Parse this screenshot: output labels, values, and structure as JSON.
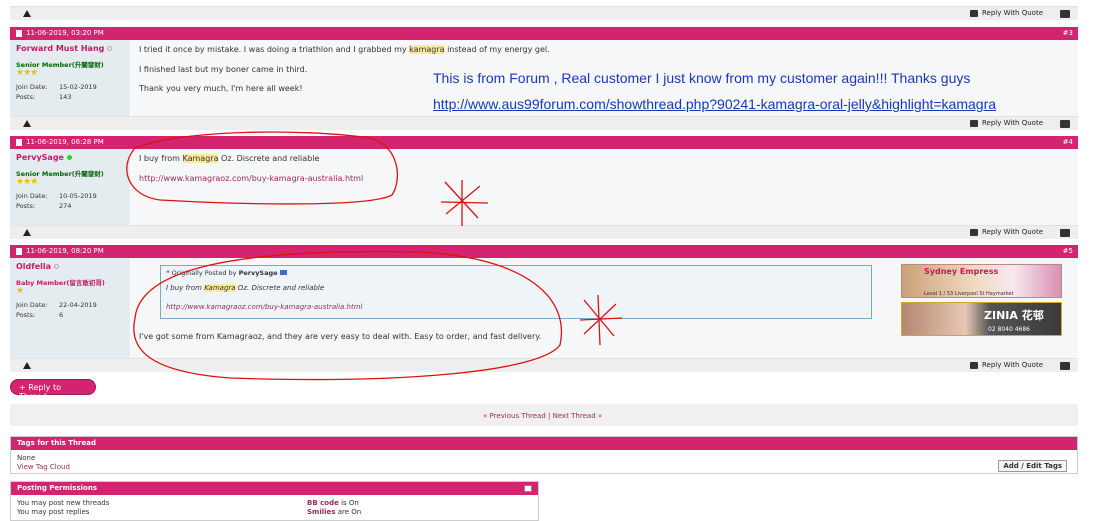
{
  "toolbar": {
    "reply_quote": "Reply With Quote"
  },
  "posts": [
    {
      "date": "11-06-2019, 03:20 PM",
      "number": "#3",
      "user": {
        "name": "Forward Must Hang",
        "rank": "Senior Member(升關發財)",
        "stars": "★★★",
        "join_label": "Join Date:",
        "join": "15-02-2019",
        "posts_label": "Posts:",
        "posts": "143"
      },
      "body": {
        "line1_pre": "I tried it once by mistake. I was doing a triathlon and I grabbed my ",
        "line1_hl": "kamagra",
        "line1_post": " instead of my energy gel.",
        "line2": "I finished last but my boner came in third.",
        "line3": "Thank you very much, I'm here all week!"
      }
    },
    {
      "date": "11-06-2019, 06:28 PM",
      "number": "#4",
      "user": {
        "name": "PervySage",
        "rank": "Senior Member(升關發財)",
        "stars": "★★★",
        "join_label": "Join Date:",
        "join": "10-05-2019",
        "posts_label": "Posts:",
        "posts": "274"
      },
      "body": {
        "line1_pre": "I buy from ",
        "line1_hl": "Kamagra",
        "line1_post": " Oz. Discrete and reliable",
        "link": "http://www.kamagraoz.com/buy-kamagra-australia.html"
      }
    },
    {
      "date": "11-06-2019, 08:20 PM",
      "number": "#5",
      "user": {
        "name": "Oldfella",
        "rank": "Baby Member(留言敢初哥)",
        "stars": "★",
        "join_label": "Join Date:",
        "join": "22-04-2019",
        "posts_label": "Posts:",
        "posts": "6"
      },
      "quote": {
        "by_label": "Originally Posted by",
        "by": "PervySage",
        "line1_pre": "I buy from ",
        "line1_hl": "Kamagra",
        "line1_post": " Oz. Discrete and reliable",
        "link": "http://www.kamagraoz.com/buy-kamagra-australia.html"
      },
      "body": {
        "line": "I've got some from Kamagraoz, and they are very easy to deal with. Easy to order, and fast delivery."
      }
    }
  ],
  "annotation": {
    "text": "This is from Forum , Real customer I just know from my customer again!!! Thanks guys",
    "link": "http://www.aus99forum.com/showthread.php?90241-kamagra-oral-jelly&highlight=kamagra"
  },
  "ads": {
    "ad1_title": "Sydney Empress",
    "ad1_line": "Level 1 / 53 Liverpool St Haymarket",
    "ad2_title": "ZINIA 花邨",
    "ad2_phone": "02 8040 4686"
  },
  "reply_button": "+ Reply to Thread",
  "thread_nav": {
    "prev": "« Previous Thread",
    "sep": "|",
    "next": "Next Thread »"
  },
  "tags": {
    "title": "Tags for this Thread",
    "none": "None",
    "cloud": "View Tag Cloud",
    "edit": "Add / Edit Tags"
  },
  "perms": {
    "title": "Posting Permissions",
    "line1": "You may post new threads",
    "line2": "You may post replies",
    "bb_label": "BB code",
    "bb_val": "is On",
    "sm_label": "Smilies",
    "sm_val": "are On"
  },
  "colors": {
    "accent": "#d4246f",
    "annotation": "#1d36b8",
    "circle": "#dd1111"
  }
}
